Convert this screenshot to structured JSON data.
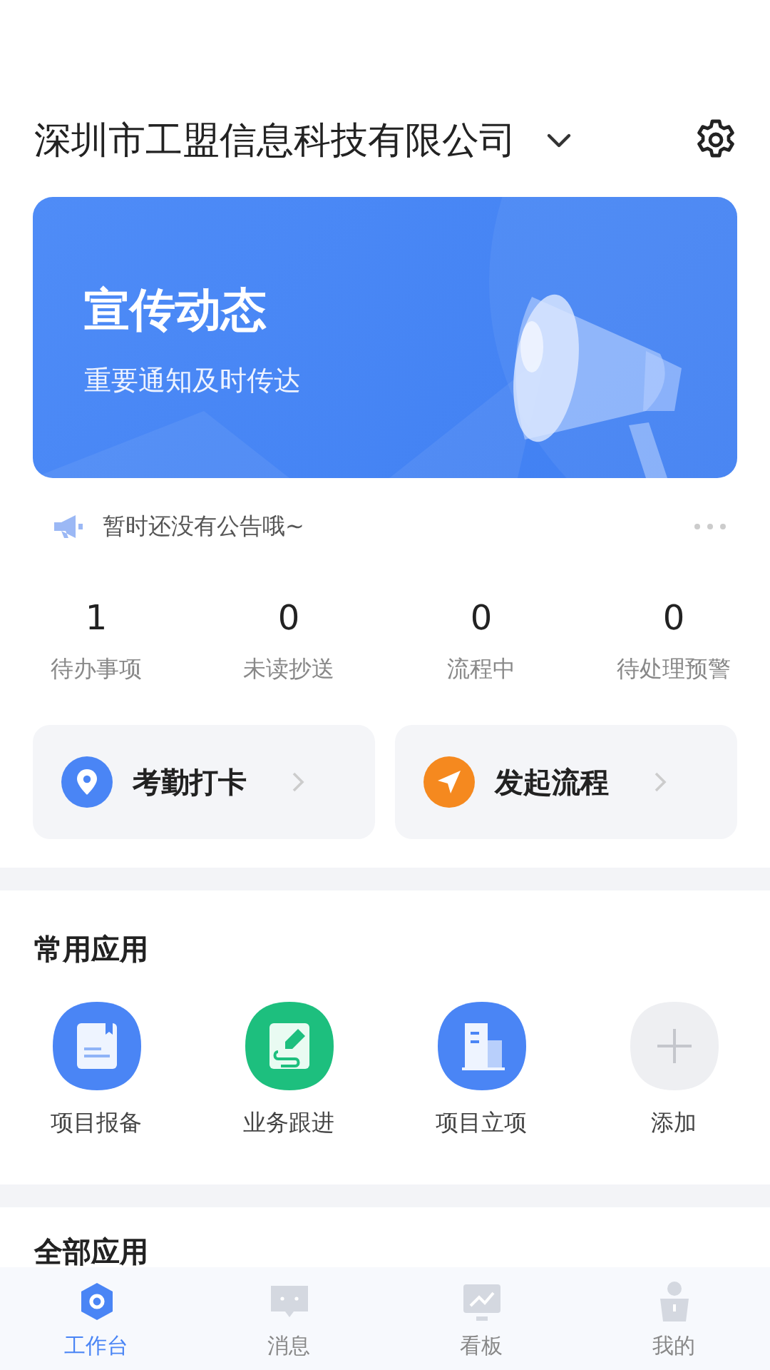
{
  "header": {
    "company": "深圳市工盟信息科技有限公司"
  },
  "banner": {
    "title": "宣传动态",
    "subtitle": "重要通知及时传达"
  },
  "notice": {
    "text": "暂时还没有公告哦~"
  },
  "stats": [
    {
      "value": "1",
      "label": "待办事项"
    },
    {
      "value": "0",
      "label": "未读抄送"
    },
    {
      "value": "0",
      "label": "流程中"
    },
    {
      "value": "0",
      "label": "待处理预警"
    }
  ],
  "shortcuts": [
    {
      "kind": "location",
      "label": "考勤打卡",
      "color": "#4a85f5"
    },
    {
      "kind": "send",
      "label": "发起流程",
      "color": "#f5891f"
    }
  ],
  "common_apps": {
    "title": "常用应用",
    "items": [
      {
        "kind": "report",
        "label": "项目报备",
        "color": "#4a85f5"
      },
      {
        "kind": "followup",
        "label": "业务跟进",
        "color": "#1dbf7e"
      },
      {
        "kind": "building",
        "label": "项目立项",
        "color": "#4a85f5"
      },
      {
        "kind": "add",
        "label": "添加",
        "color": "#eeeff2"
      }
    ]
  },
  "all_apps": {
    "title": "全部应用"
  },
  "tabs": [
    {
      "kind": "workbench",
      "label": "工作台",
      "selected": true
    },
    {
      "kind": "message",
      "label": "消息",
      "selected": false
    },
    {
      "kind": "board",
      "label": "看板",
      "selected": false
    },
    {
      "kind": "me",
      "label": "我的",
      "selected": false
    }
  ]
}
